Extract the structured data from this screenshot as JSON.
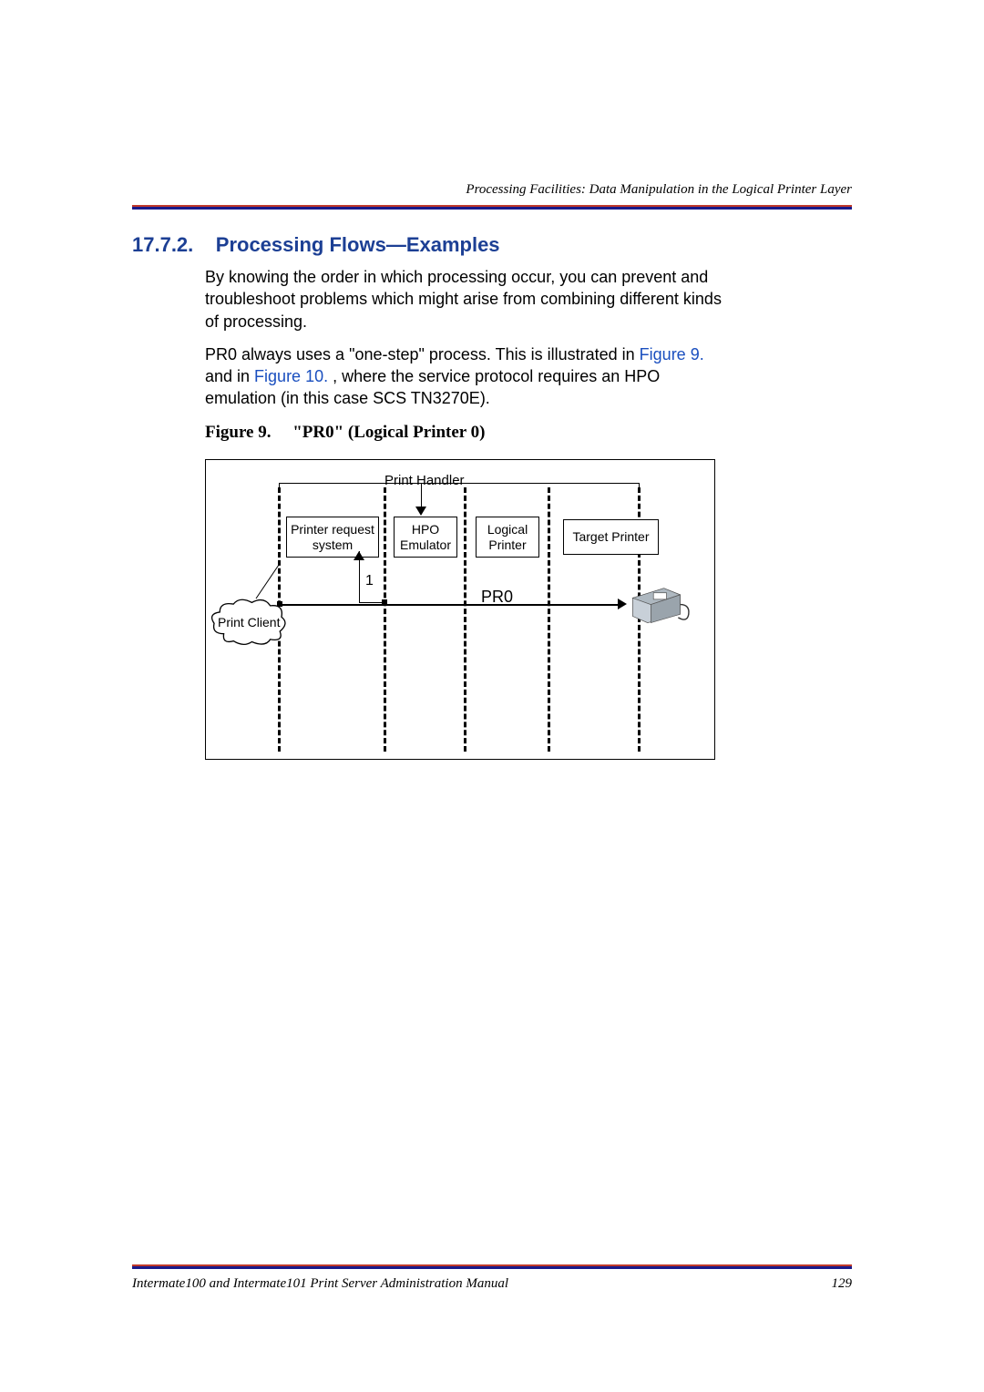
{
  "header": {
    "running_head": "Processing Facilities: Data Manipulation in the Logical Printer Layer"
  },
  "section": {
    "number": "17.7.2.",
    "title": "Processing Flows—Examples"
  },
  "paragraphs": {
    "p1": "By knowing the order in which processing occur, you can prevent and troubleshoot problems which might arise from combining different kinds of processing.",
    "p2a": "PR0 always uses a \"one-step\" process. This is illustrated in ",
    "link1": "Figure 9.",
    "p2b": " and in ",
    "link2": "Figure 10.",
    "p2c": ", where the service protocol requires an HPO emulation (in this case SCS TN3270E)."
  },
  "figure": {
    "caption_label": "Figure 9.",
    "caption_title": "\"PR0\" (Logical Printer 0)",
    "labels": {
      "print_handler": "Print Handler",
      "printer_request_system": "Printer request\nsystem",
      "hpo_emulator": "HPO\nEmulator",
      "logical_printer": "Logical\nPrinter",
      "target_printer": "Target Printer",
      "print_client": "Print Client",
      "pr0": "PR0",
      "step1": "1"
    }
  },
  "footer": {
    "manual_title": "Intermate100 and Intermate101 Print Server Administration Manual",
    "page_number": "129"
  }
}
